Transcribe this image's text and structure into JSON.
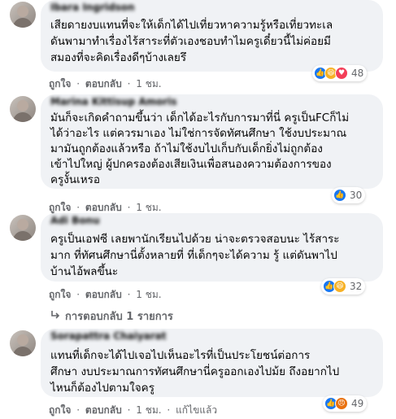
{
  "comments": [
    {
      "author": "Ibara Ingridson",
      "text": "เสียดายงบแทนที่จะให้เด็กได้ไปเที่ยวหาความรู้หรือเที่ยวทะเลดันพามาทำเรื่องไร้สาระที่ตัวเองชอบทำไมครูเดี๋ยวนี้ไม่ค่อยมีสมองที่จะคิดเรื่องดีๆบ้างเลยรึ",
      "lines": [
        "เสียดายงบแทนที่จะให้เด็กได้ไปเที่ยวหาความรู้หรือเที่ยวทะเล",
        "ดันพามาทำเรื่องไร้สาระที่ตัวเองชอบทำไมครูเดี๋ยวนี้ไม่ค่อยมี",
        "สมองที่จะคิดเรื่องดีๆบ้างเลยรึ"
      ],
      "like": "ถูกใจ",
      "reply": "ตอบกลับ",
      "time": "1 ชม.",
      "reactions": [
        "like",
        "haha",
        "love"
      ],
      "count": "48"
    },
    {
      "author": "Marina Kittisup Amoris",
      "lines": [
        "มันก็จะเกิดคำถามขึ้นว่า เด็กได้อะไรกับการมาที่นี่ ครูเป็นFCก็ไม่",
        "ได้ว่าอะไร แต่ควรมาเอง ไม่ใช่การจัดทัศนศึกษา ใช้งบประมาณ",
        "มามันถูกต้องแล้วหรือ ถ้าไม่ใช้งบไปเก็บกับเด็กยิ่งไม่ถูกต้อง",
        "เข้าไปใหญ่ ผู้ปกครองต้องเสียเงินเพื่อสนองความต้องการของ",
        "ครูงั้นเหรอ"
      ],
      "like": "ถูกใจ",
      "reply": "ตอบกลับ",
      "time": "1 ชม.",
      "reactions": [
        "like"
      ],
      "count": "30"
    },
    {
      "author": "Adi Bonu",
      "lines": [
        "ครูเป็นเอฟซี เลยพานักเรียนไปด้วย น่าจะตรวจสอบนะ ไร้สาระ",
        "มาก ที่ทัศนศึกษานี่ตั้งหลายที่ ที่เด็กๆจะได้ความ รู้ แต่ดันพาไป",
        "บ้านไอ้พลขึ้นะ"
      ],
      "like": "ถูกใจ",
      "reply": "ตอบกลับ",
      "time": "1 ชม.",
      "reactions": [
        "like",
        "haha"
      ],
      "count": "32"
    },
    {
      "author": "Sorapattra Chaiyarat",
      "lines": [
        "แทนที่เด็กจะได้ไปเจอไปเห็นอะไรที่เป็นประโยชน์ต่อการ",
        "ศึกษา งบประมาณการทัศนศึกษานี่ครูออกเองไปม้ย ถึงอยากไป",
        "ไหนก็ต้องไปตามใจครู"
      ],
      "like": "ถูกใจ",
      "reply": "ตอบกลับ",
      "time": "1 ชม.",
      "edited": "แก้ไขแล้ว",
      "reactions": [
        "like",
        "angry"
      ],
      "count": "49"
    }
  ],
  "replies_link": "การตอบกลับ 1 รายการ",
  "dot": "·",
  "colors": {
    "like": "#1877f2",
    "haha": "#f7b125",
    "love": "#f33e58",
    "angry": "#e9710f",
    "bubble": "#f0f2f5",
    "meta": "#65676b"
  }
}
